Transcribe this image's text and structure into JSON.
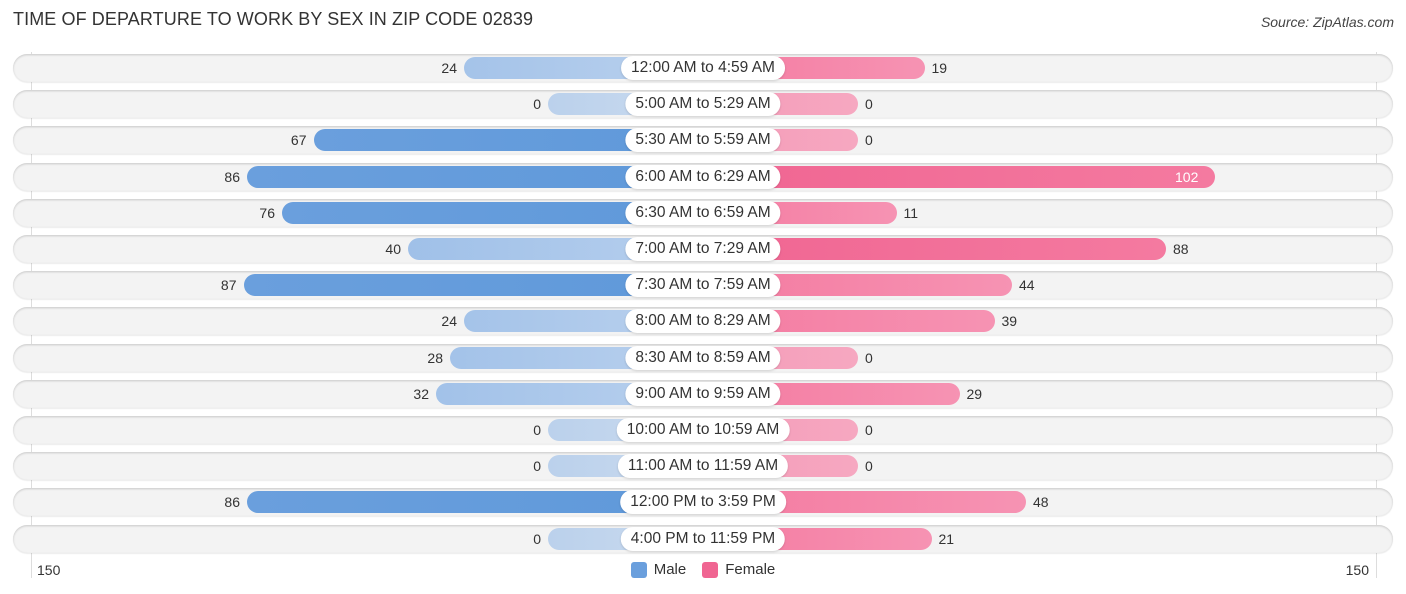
{
  "title": "TIME OF DEPARTURE TO WORK BY SEX IN ZIP CODE 02839",
  "source": "Source: ZipAtlas.com",
  "colors": {
    "male": "#6a9fdd",
    "female": "#f06592",
    "male_light": "#a9c7ec",
    "female_light": "#f6a8c1"
  },
  "chart_data": {
    "type": "bar",
    "orientation": "horizontal-diverging",
    "title": "TIME OF DEPARTURE TO WORK BY SEX IN ZIP CODE 02839",
    "categories": [
      "12:00 AM to 4:59 AM",
      "5:00 AM to 5:29 AM",
      "5:30 AM to 5:59 AM",
      "6:00 AM to 6:29 AM",
      "6:30 AM to 6:59 AM",
      "7:00 AM to 7:29 AM",
      "7:30 AM to 7:59 AM",
      "8:00 AM to 8:29 AM",
      "8:30 AM to 8:59 AM",
      "9:00 AM to 9:59 AM",
      "10:00 AM to 10:59 AM",
      "11:00 AM to 11:59 AM",
      "12:00 PM to 3:59 PM",
      "4:00 PM to 11:59 PM"
    ],
    "series": [
      {
        "name": "Male",
        "values": [
          24,
          0,
          67,
          86,
          76,
          40,
          87,
          24,
          28,
          32,
          0,
          0,
          86,
          0
        ]
      },
      {
        "name": "Female",
        "values": [
          19,
          0,
          0,
          102,
          11,
          88,
          44,
          39,
          0,
          29,
          0,
          0,
          48,
          21
        ]
      }
    ],
    "axis": {
      "left_label": "150",
      "right_label": "150",
      "range": [
        0,
        150
      ]
    },
    "legend": {
      "position": "bottom-center",
      "entries": [
        "Male",
        "Female"
      ]
    },
    "xlabel": "",
    "ylabel": ""
  }
}
